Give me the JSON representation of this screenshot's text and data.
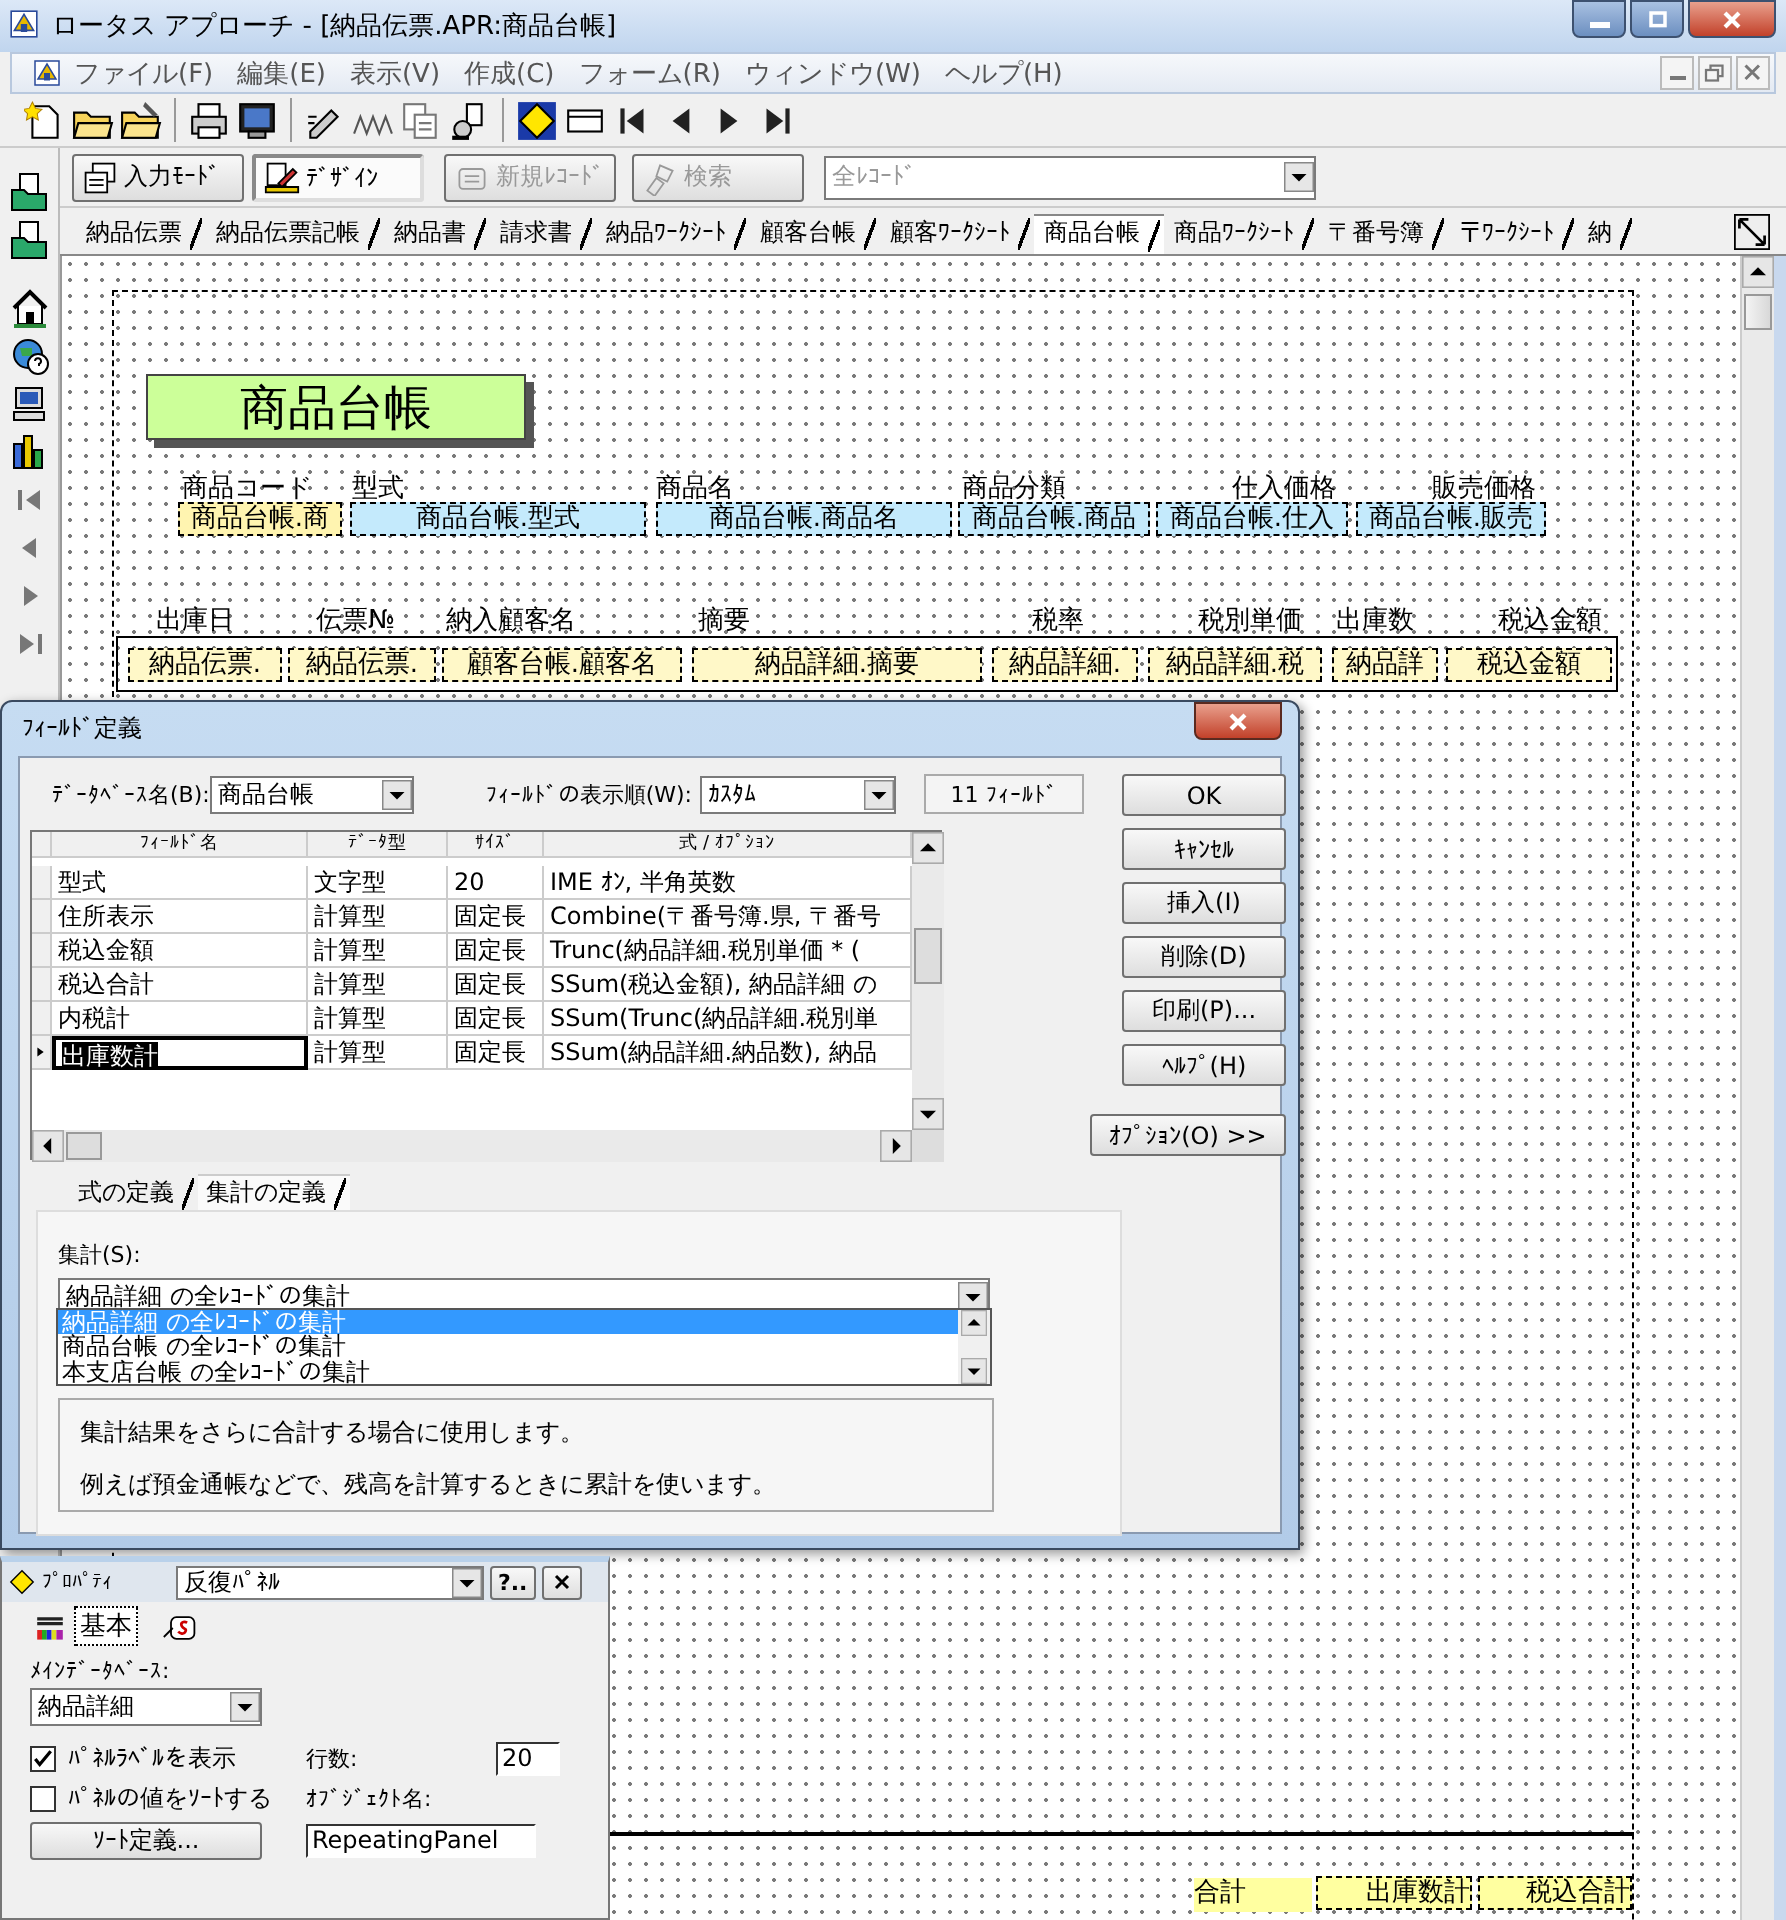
{
  "window": {
    "title": "ロータス アプローチ - [納品伝票.APR:商品台帳]"
  },
  "menu": [
    "ファイル(F)",
    "編集(E)",
    "表示(V)",
    "作成(C)",
    "フォーム(R)",
    "ウィンドウ(W)",
    "ヘルプ(H)"
  ],
  "mode_bar": {
    "modes": [
      {
        "label": "入力ﾓｰﾄﾞ",
        "selected": false
      },
      {
        "label": "ﾃﾞｻﾞｲﾝ",
        "selected": true
      }
    ],
    "new_record": {
      "label": "新規ﾚｺｰﾄﾞ",
      "disabled": true
    },
    "find": {
      "label": "検索",
      "disabled": true
    },
    "record_filter": {
      "value": "全ﾚｺｰﾄﾞ",
      "disabled": true
    }
  },
  "view_tabs": [
    {
      "label": "納品伝票",
      "selected": false
    },
    {
      "label": "納品伝票記帳",
      "selected": false
    },
    {
      "label": "納品書",
      "selected": false
    },
    {
      "label": "請求書",
      "selected": false
    },
    {
      "label": "納品ﾜｰｸｼｰﾄ",
      "selected": false
    },
    {
      "label": "顧客台帳",
      "selected": false
    },
    {
      "label": "顧客ﾜｰｸｼｰﾄ",
      "selected": false
    },
    {
      "label": "商品台帳",
      "selected": true
    },
    {
      "label": "商品ﾜｰｸｼｰﾄ",
      "selected": false
    },
    {
      "label": "〒番号簿",
      "selected": false
    },
    {
      "label": "〒ﾜｰｸｼｰﾄ",
      "selected": false
    },
    {
      "label": "納",
      "selected": false
    }
  ],
  "form": {
    "title": "商品台帳",
    "header_labels": [
      "商品コード",
      "型式",
      "商品名",
      "商品分類",
      "仕入価格",
      "販売価格"
    ],
    "header_fields": [
      {
        "text": "商品台帳.商",
        "color": "#fff4b0"
      },
      {
        "text": "商品台帳.型式",
        "color": "#c4eafc"
      },
      {
        "text": "商品台帳.商品名",
        "color": "#c4eafc"
      },
      {
        "text": "商品台帳.商品",
        "color": "#c4eafc"
      },
      {
        "text": "商品台帳.仕入",
        "color": "#c4eafc"
      },
      {
        "text": "商品台帳.販売",
        "color": "#c4eafc"
      }
    ],
    "panel_labels": [
      "出庫日",
      "伝票№",
      "納入顧客名",
      "摘要",
      "税率",
      "税別単価",
      "出庫数",
      "税込金額"
    ],
    "panel_fields": [
      "納品伝票.",
      "納品伝票.",
      "顧客台帳.顧客名",
      "納品詳細.摘要",
      "納品詳細.",
      "納品詳細.税",
      "納品詳",
      "税込金額"
    ],
    "summary_label": "合計",
    "summary_fields": [
      "出庫数計",
      "税込合計"
    ]
  },
  "dialog": {
    "title": "ﾌｨｰﾙﾄﾞ定義",
    "database_label": "ﾃﾞｰﾀﾍﾞｰｽ名(B):",
    "database": "商品台帳",
    "order_label": "ﾌｨｰﾙﾄﾞの表示順(W):",
    "order": "ｶｽﾀﾑ",
    "field_count": "11 ﾌｨｰﾙﾄﾞ",
    "columns": [
      "ﾌｨｰﾙﾄﾞ名",
      "ﾃﾞｰﾀ型",
      "ｻｲｽﾞ",
      "式 / ｵﾌﾟｼｮﾝ"
    ],
    "rows": [
      {
        "cells": [
          "型式",
          "文字型",
          "20",
          "IME ｵﾝ, 半角英数"
        ],
        "selected": false
      },
      {
        "cells": [
          "住所表示",
          "計算型",
          "固定長",
          "Combine(〒番号簿.県, 〒番号"
        ],
        "selected": false
      },
      {
        "cells": [
          "税込金額",
          "計算型",
          "固定長",
          "Trunc(納品詳細.税別単価 * ("
        ],
        "selected": false
      },
      {
        "cells": [
          "税込合計",
          "計算型",
          "固定長",
          "SSum(税込金額), 納品詳細 の"
        ],
        "selected": false
      },
      {
        "cells": [
          "内税計",
          "計算型",
          "固定長",
          "SSum(Trunc(納品詳細.税別単"
        ],
        "selected": false
      },
      {
        "cells": [
          "出庫数計",
          "計算型",
          "固定長",
          "SSum(納品詳細.納品数), 納品"
        ],
        "selected": true
      }
    ],
    "buttons": [
      "OK",
      "ｷｬﾝｾﾙ",
      "挿入(I)",
      "削除(D)",
      "印刷(P)...",
      "ﾍﾙﾌﾟ(H)"
    ],
    "options_button": "ｵﾌﾟｼｮﾝ(O) >>",
    "tabs": [
      {
        "label": "式の定義",
        "selected": false
      },
      {
        "label": "集計の定義",
        "selected": true
      }
    ],
    "summary": {
      "label": "集計(S):",
      "value": "納品詳細 の全ﾚｺｰﾄﾞの集計",
      "options": [
        {
          "label": "納品詳細 の全ﾚｺｰﾄﾞの集計",
          "selected": true
        },
        {
          "label": "商品台帳 の全ﾚｺｰﾄﾞの集計",
          "selected": false
        },
        {
          "label": "本支店台帳 の全ﾚｺｰﾄﾞの集計",
          "selected": false
        }
      ]
    },
    "hint": [
      "集計結果をさらに合計する場合に使用します。",
      "例えば預金通帳などで、残高を計算するときに累計を使います。"
    ]
  },
  "properties": {
    "title": "ﾌﾟﾛﾊﾟﾃｨ",
    "object": "反復ﾊﾟﾈﾙ",
    "help_button": "?..",
    "tabs": [
      {
        "label": "基本",
        "selected": true
      }
    ],
    "main_db_label": "ﾒｲﾝﾃﾞｰﾀﾍﾞｰｽ:",
    "main_db": "納品詳細",
    "checks": [
      {
        "label": "ﾊﾟﾈﾙﾗﾍﾞﾙを表示",
        "checked": true
      },
      {
        "label": "ﾊﾟﾈﾙの値をｿｰﾄする",
        "checked": false
      }
    ],
    "sort_button": "ｿｰﾄ定義...",
    "row_count_label": "行数:",
    "row_count": "20",
    "name_label": "ｵﾌﾞｼﾞｪｸﾄ名:",
    "name": "RepeatingPanel"
  }
}
